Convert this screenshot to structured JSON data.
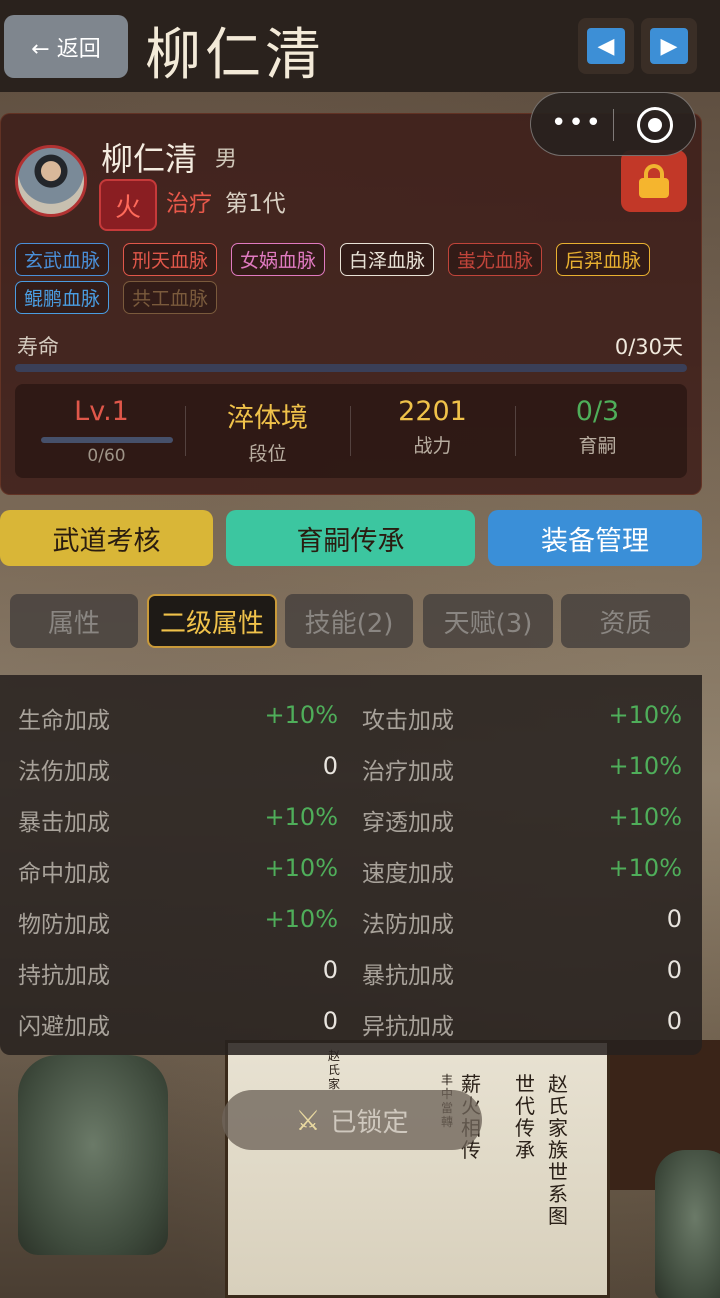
{
  "header": {
    "back_label": "← 返回",
    "title": "柳仁清",
    "prev_icon": "◀",
    "next_icon": "▶"
  },
  "capsule": {
    "more_icon": "•••"
  },
  "character": {
    "name": "柳仁清",
    "gender": "男",
    "element": "火",
    "role": "治疗",
    "generation": "第1代",
    "bloodlines": [
      {
        "label": "玄武血脉",
        "color": "#4a8fd8"
      },
      {
        "label": "刑天血脉",
        "color": "#e0574a"
      },
      {
        "label": "女娲血脉",
        "color": "#e07ac0"
      },
      {
        "label": "白泽血脉",
        "color": "#e8e2d6"
      },
      {
        "label": "蚩尤血脉",
        "color": "#c0443a"
      },
      {
        "label": "后羿血脉",
        "color": "#e8b030"
      },
      {
        "label": "鲲鹏血脉",
        "color": "#4a9ce0"
      },
      {
        "label": "共工血脉",
        "color": "#7a5a3c"
      }
    ],
    "lifespan_label": "寿命",
    "lifespan_value": "0/30天",
    "lifespan_progress": 0
  },
  "stats": {
    "level": "Lv.1",
    "level_exp": "0/60",
    "level_progress": 0,
    "realm": "淬体境",
    "realm_label": "段位",
    "power": "2201",
    "power_label": "战力",
    "offspring": "0/3",
    "offspring_label": "育嗣"
  },
  "actions": [
    {
      "label": "武道考核",
      "color": "#d9b637"
    },
    {
      "label": "育嗣传承",
      "color": "#3cc6a0"
    },
    {
      "label": "装备管理",
      "color": "#3a8fd8"
    }
  ],
  "tabs": [
    "属性",
    "二级属性",
    "技能(2)",
    "天赋(3)",
    "资质"
  ],
  "active_tab": "二级属性",
  "attributes": [
    {
      "left": {
        "name": "生命加成",
        "value": "+10%"
      },
      "right": {
        "name": "攻击加成",
        "value": "+10%"
      }
    },
    {
      "left": {
        "name": "法伤加成",
        "value": "0"
      },
      "right": {
        "name": "治疗加成",
        "value": "+10%"
      }
    },
    {
      "left": {
        "name": "暴击加成",
        "value": "+10%"
      },
      "right": {
        "name": "穿透加成",
        "value": "+10%"
      }
    },
    {
      "left": {
        "name": "命中加成",
        "value": "+10%"
      },
      "right": {
        "name": "速度加成",
        "value": "+10%"
      }
    },
    {
      "left": {
        "name": "物防加成",
        "value": "+10%"
      },
      "right": {
        "name": "法防加成",
        "value": "0"
      }
    },
    {
      "left": {
        "name": "持抗加成",
        "value": "0"
      },
      "right": {
        "name": "暴抗加成",
        "value": "0"
      }
    },
    {
      "left": {
        "name": "闪避加成",
        "value": "0"
      },
      "right": {
        "name": "异抗加成",
        "value": "0"
      }
    }
  ],
  "locked_label": "已锁定",
  "background_art": {
    "scroll_columns": [
      "赵氏家族世系图",
      "世代传承",
      "薪火相传",
      "赵氏家",
      "丰中當轉"
    ]
  }
}
